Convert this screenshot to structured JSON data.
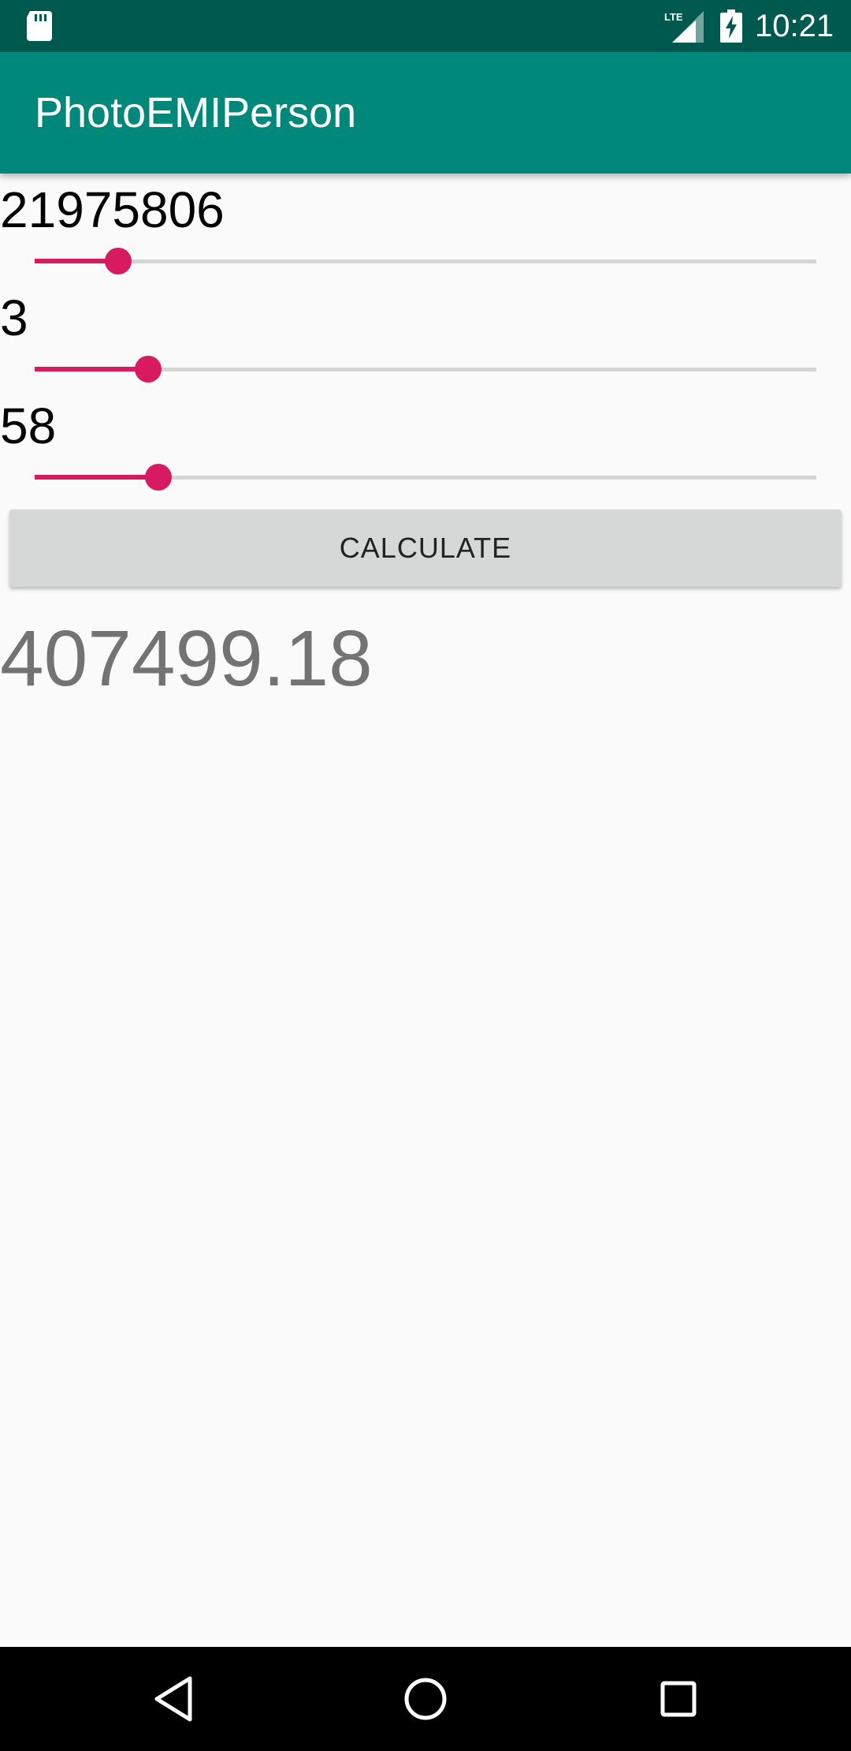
{
  "status_bar": {
    "time": "10:21",
    "network": "LTE",
    "icons": [
      "sd-card-icon",
      "signal-icon",
      "battery-charging-icon"
    ]
  },
  "app_bar": {
    "title": "PhotoEMIPerson"
  },
  "sliders": [
    {
      "value_text": "21975806",
      "level": 0.107
    },
    {
      "value_text": "3",
      "level": 0.145
    },
    {
      "value_text": "58",
      "level": 0.158
    }
  ],
  "calculate_button": {
    "label": "CALCULATE"
  },
  "result": {
    "value": "407499.18"
  },
  "nav_bar": {
    "icons": [
      "back-icon",
      "home-icon",
      "recents-icon"
    ]
  },
  "colors": {
    "status_bar": "#00594f",
    "app_bar": "#00897b",
    "accent": "#d81b60",
    "slider_track": "#d5d5d5",
    "button": "#d6d7d7",
    "background": "#fafafa",
    "result_text": "#737373"
  }
}
